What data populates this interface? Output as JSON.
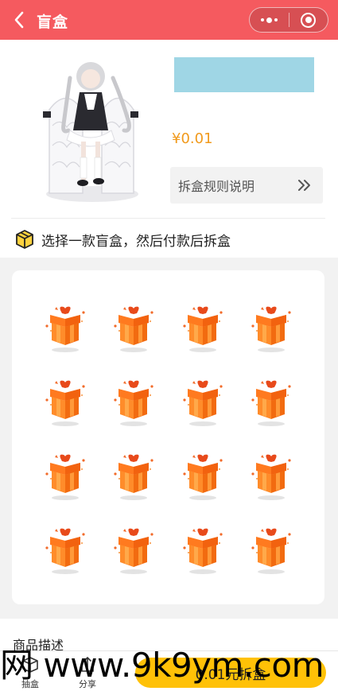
{
  "header": {
    "title": "盲盒",
    "bg_color": "#f55a5f"
  },
  "product": {
    "price": "¥0.01",
    "rules_label": "拆盒规则说明"
  },
  "hint": {
    "text": "选择一款盲盒，然后付款后拆盒"
  },
  "boxes": [
    {
      "icon": "gift-box-icon"
    },
    {
      "icon": "gift-box-icon"
    },
    {
      "icon": "gift-box-icon"
    },
    {
      "icon": "gift-box-icon"
    },
    {
      "icon": "gift-box-icon"
    },
    {
      "icon": "gift-box-icon"
    },
    {
      "icon": "gift-box-icon"
    },
    {
      "icon": "gift-box-icon"
    },
    {
      "icon": "gift-box-icon"
    },
    {
      "icon": "gift-box-icon"
    },
    {
      "icon": "gift-box-icon"
    },
    {
      "icon": "gift-box-icon"
    },
    {
      "icon": "gift-box-icon"
    },
    {
      "icon": "gift-box-icon"
    },
    {
      "icon": "gift-box-icon"
    },
    {
      "icon": "gift-box-icon"
    }
  ],
  "description": {
    "title": "商品描述"
  },
  "bottom_bar": {
    "home_label": "抽盒",
    "share_label": "分享",
    "action_label": "0.01元拆盒",
    "action_color": "#ffc107"
  },
  "watermark": {
    "text": "网 www.9k9ym.com"
  }
}
